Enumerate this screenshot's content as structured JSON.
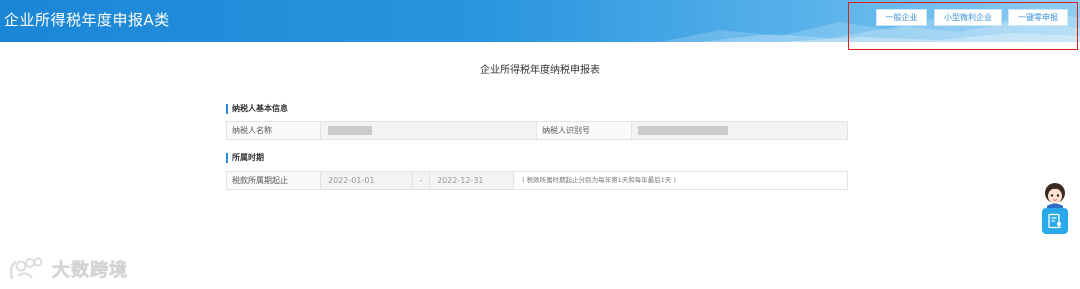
{
  "header": {
    "title": "企业所得税年度申报A类",
    "buttons": [
      "一般企业",
      "小型微利企业",
      "一键零申报"
    ],
    "gradient_start": "#1a86d6",
    "gradient_end": "#8fcdf2"
  },
  "form": {
    "title": "企业所得税年度纳税申报表",
    "basic_info": {
      "section_label": "纳税人基本信息",
      "taxpayer_name_label": "纳税人名称",
      "taxpayer_name_value": "",
      "taxpayer_id_label": "纳税人识别号",
      "taxpayer_id_value": ""
    },
    "period": {
      "section_label": "所属时期",
      "period_label": "税款所属期起止",
      "start_date": "2022-01-01",
      "separator": "-",
      "end_date": "2022-12-31",
      "hint": "( 税款所属时期起止分别为每年第1天和每年最后1天 )"
    }
  },
  "sidebar": {
    "assistant_icon": "avatar-icon",
    "action_icon": "document-user-icon",
    "accent_color": "#2aa9ea"
  },
  "watermark": {
    "text": "大数跨境",
    "icon": "brand-logo-icon"
  },
  "highlight_color": "#e02020"
}
